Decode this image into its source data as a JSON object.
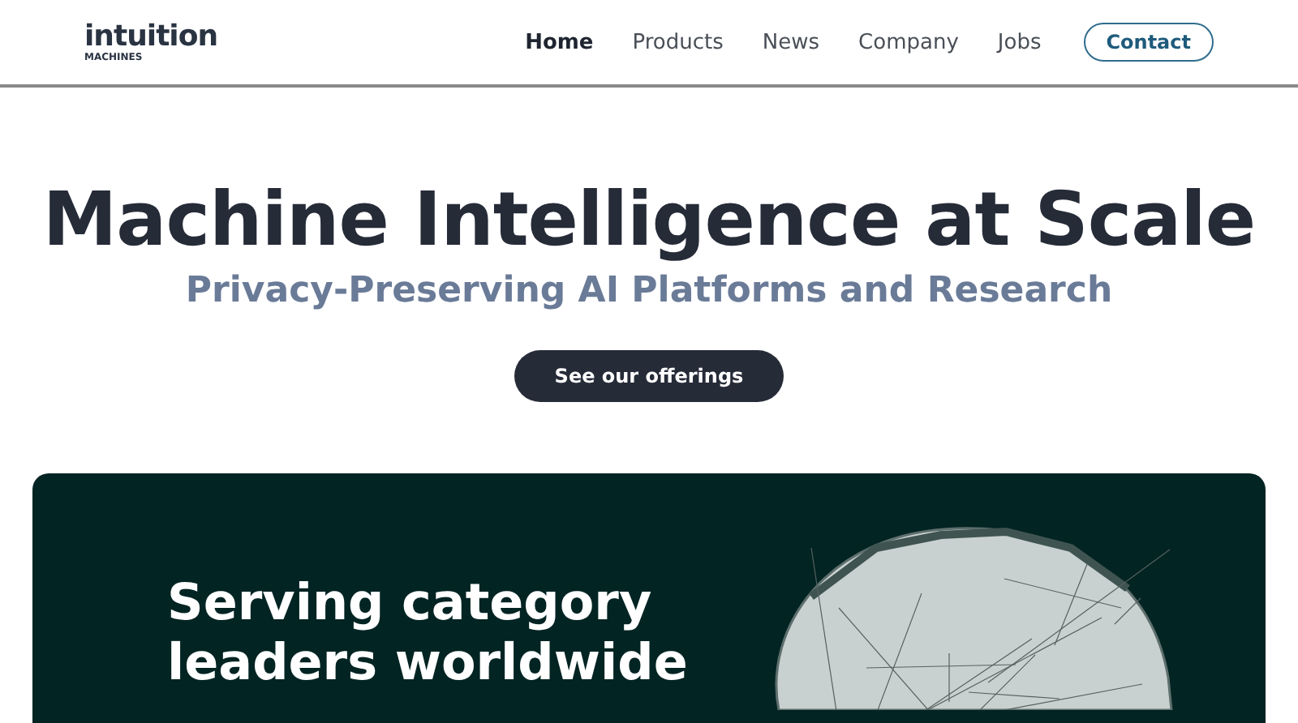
{
  "logo": {
    "name": "intuition",
    "sub": "MACHINES"
  },
  "nav": [
    {
      "label": "Home",
      "selected": true
    },
    {
      "label": "Products",
      "selected": false
    },
    {
      "label": "News",
      "selected": false
    },
    {
      "label": "Company",
      "selected": false
    },
    {
      "label": "Jobs",
      "selected": false
    }
  ],
  "contact_button": "Contact",
  "hero": {
    "title": "Machine Intelligence at Scale",
    "subtitle": "Privacy-Preserving AI Platforms and Research",
    "button": "See our offerings"
  },
  "feature_card": {
    "heading": "Serving category leaders worldwide"
  }
}
